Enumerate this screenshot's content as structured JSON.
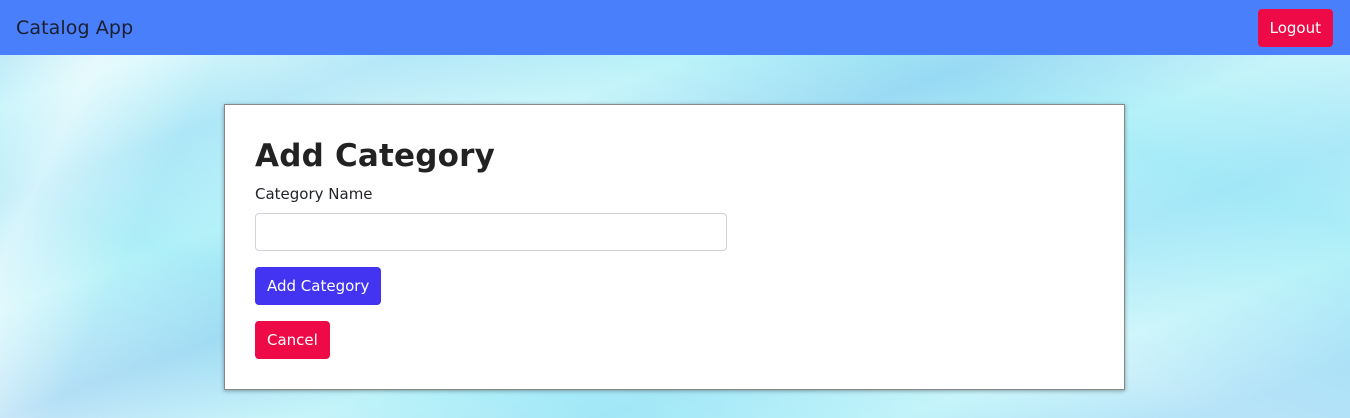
{
  "navbar": {
    "brand": "Catalog App",
    "logout_label": "Logout"
  },
  "form": {
    "title": "Add Category",
    "category_name_label": "Category Name",
    "category_name_value": "",
    "category_name_placeholder": "",
    "submit_label": "Add Category",
    "cancel_label": "Cancel"
  },
  "colors": {
    "navbar_bg": "#4a7ffb",
    "primary": "#4334f2",
    "danger": "#ee0a46",
    "background": "#aef0f8"
  }
}
